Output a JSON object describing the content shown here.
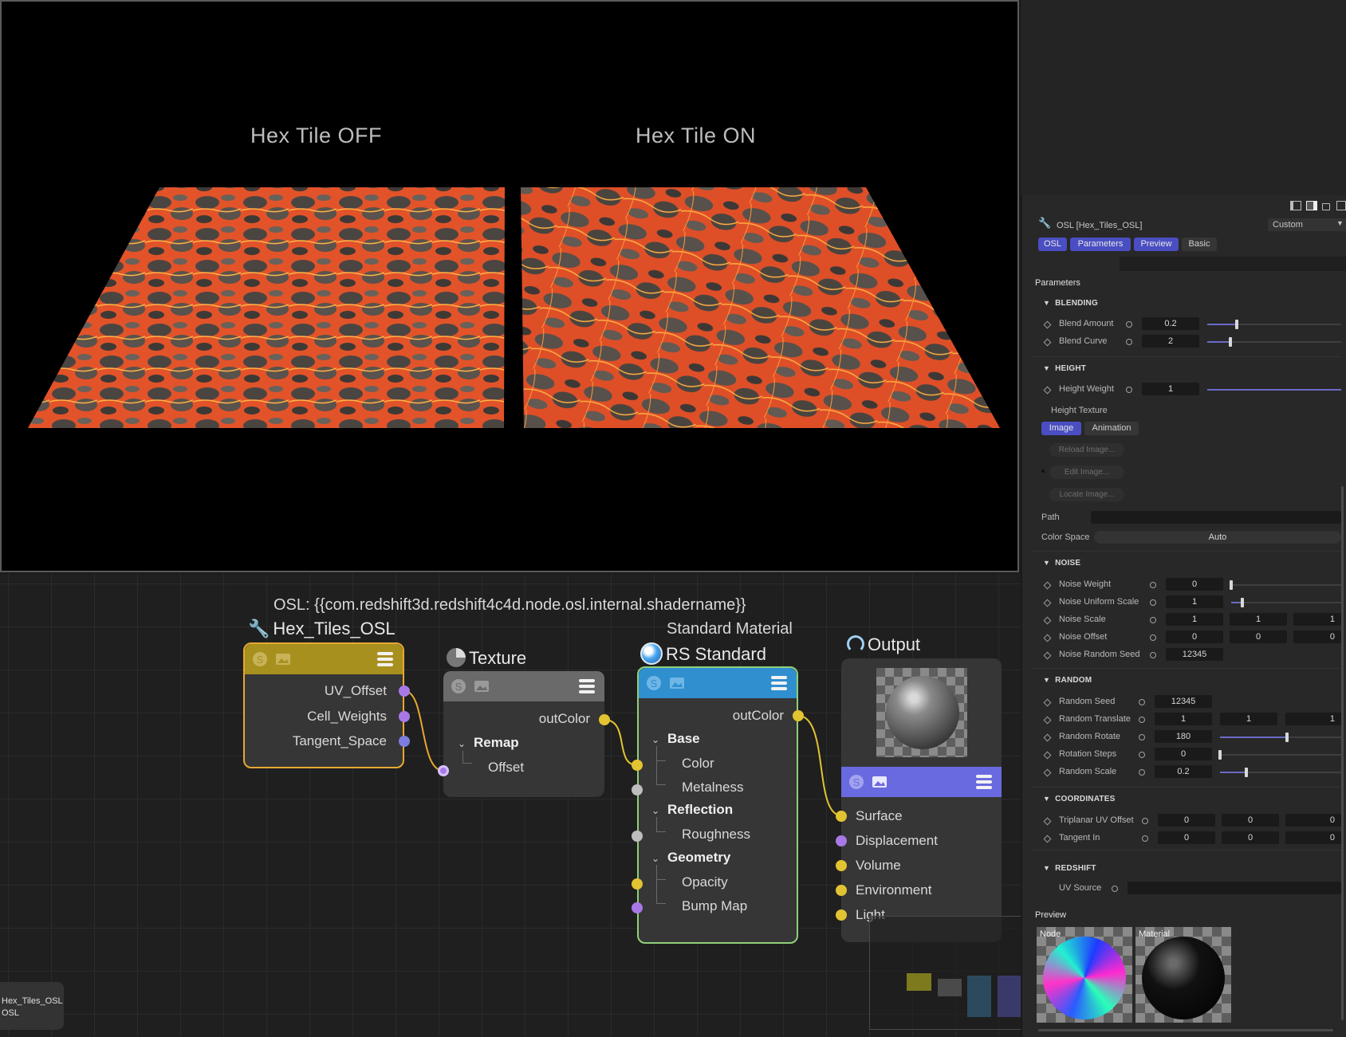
{
  "viewport": {
    "label_left": "Hex Tile OFF",
    "label_right": "Hex Tile ON"
  },
  "node_editor": {
    "osl_caption": "OSL: {{com.redshift3d.redshift4c4d.node.osl.internal.shadername}}",
    "nodes": {
      "hex": {
        "title": "Hex_Tiles_OSL",
        "ports": [
          "UV_Offset",
          "Cell_Weights",
          "Tangent_Space"
        ]
      },
      "texture": {
        "title": "Texture",
        "out": "outColor",
        "group": "Remap",
        "group_item": "Offset"
      },
      "standard": {
        "subtitle": "Standard Material",
        "title": "RS Standard",
        "out": "outColor",
        "base_group": "Base",
        "base_items": [
          "Color",
          "Metalness"
        ],
        "reflection_group": "Reflection",
        "reflection_items": [
          "Roughness"
        ],
        "geometry_group": "Geometry",
        "geometry_items": [
          "Opacity",
          "Bump Map"
        ]
      },
      "output": {
        "title": "Output",
        "ports": [
          "Surface",
          "Displacement",
          "Volume",
          "Environment",
          "Light"
        ]
      }
    },
    "bottom_chip": [
      "Hex_Tiles_OSL",
      "OSL"
    ]
  },
  "attributes": {
    "title": "OSL [Hex_Tiles_OSL]",
    "mode": "Custom",
    "tabs": [
      "OSL",
      "Parameters",
      "Preview",
      "Basic"
    ],
    "parameters_heading": "Parameters",
    "blending": {
      "heading": "BLENDING",
      "blend_amount_label": "Blend Amount",
      "blend_amount": "0.2",
      "blend_amount_frac": 0.22,
      "blend_curve_label": "Blend Curve",
      "blend_curve": "2",
      "blend_curve_frac": 0.17
    },
    "height": {
      "heading": "HEIGHT",
      "height_weight_label": "Height Weight",
      "height_weight": "1",
      "height_weight_frac": 1.0,
      "height_texture_label": "Height Texture",
      "texture_tabs": [
        "Image",
        "Animation"
      ],
      "reload": "Reload Image...",
      "edit": "Edit Image...",
      "locate": "Locate Image...",
      "path_label": "Path",
      "color_space_label": "Color Space",
      "color_space": "Auto"
    },
    "noise": {
      "heading": "NOISE",
      "noise_weight_label": "Noise Weight",
      "noise_weight": "0",
      "noise_weight_frac": 0.0,
      "noise_uniform_scale_label": "Noise Uniform Scale",
      "noise_uniform_scale": "1",
      "noise_uniform_scale_frac": 0.1,
      "noise_scale_label": "Noise Scale",
      "noise_scale": [
        "1",
        "1",
        "1"
      ],
      "noise_offset_label": "Noise Offset",
      "noise_offset": [
        "0",
        "0",
        "0"
      ],
      "noise_random_seed_label": "Noise Random Seed",
      "noise_random_seed": "12345"
    },
    "random": {
      "heading": "RANDOM",
      "random_seed_label": "Random Seed",
      "random_seed": "12345",
      "random_translate_label": "Random Translate",
      "random_translate": [
        "1",
        "1",
        "1"
      ],
      "random_rotate_label": "Random Rotate",
      "random_rotate": "180",
      "random_rotate_frac": 0.55,
      "rotation_steps_label": "Rotation Steps",
      "rotation_steps": "0",
      "rotation_steps_frac": 0.0,
      "random_scale_label": "Random Scale",
      "random_scale": "0.2",
      "random_scale_frac": 0.22
    },
    "coordinates": {
      "heading": "COORDINATES",
      "triplanar_label": "Triplanar UV Offset",
      "triplanar": [
        "0",
        "0",
        "0"
      ],
      "tangent_label": "Tangent In",
      "tangent": [
        "0",
        "0",
        "0"
      ]
    },
    "redshift": {
      "heading": "REDSHIFT",
      "uv_source_label": "UV Source"
    },
    "preview": {
      "heading": "Preview",
      "node_label": "Node",
      "material_label": "Material"
    }
  },
  "colors": {
    "hex_header": "#a8901f",
    "hex_border": "#e7a830",
    "texture_header": "#6a6a6a",
    "standard_header": "#2f8fcf",
    "standard_border": "#8fcf78",
    "output_header": "#6a6ae0",
    "port_yellow": "#e2c331",
    "port_purple": "#a879e6",
    "port_blue": "#7d7de0",
    "port_grey": "#bdbdbd",
    "tab_active": "#4a4ec2"
  }
}
